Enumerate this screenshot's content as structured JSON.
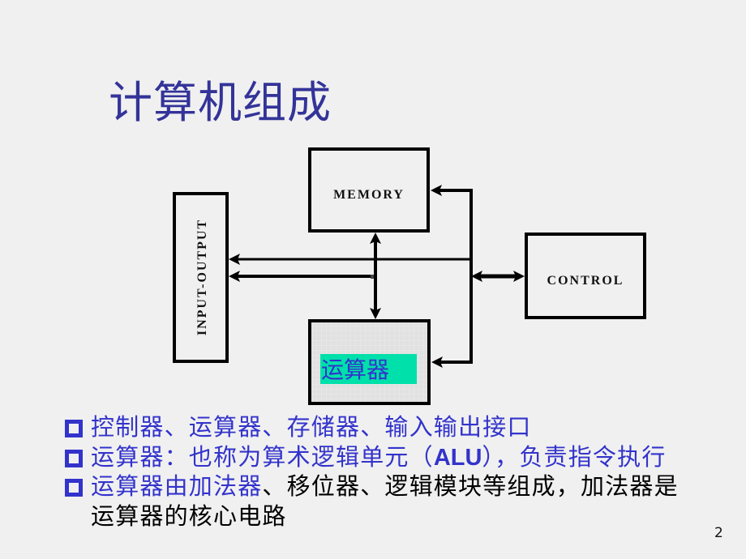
{
  "slide": {
    "title": "计算机组成",
    "page_number": "2"
  },
  "diagram": {
    "memory_label": "MEMORY",
    "control_label": "CONTROL",
    "io_label": "INPUT-OUTPUT",
    "alu_label": "运算器"
  },
  "bullets": [
    {
      "segments": [
        {
          "text": "控制器、运算器、存储器、输入输出接口",
          "color": "blue"
        }
      ]
    },
    {
      "segments": [
        {
          "text": "运算器：也称为算术逻辑单元（",
          "color": "blue"
        },
        {
          "text": "ALU",
          "color": "blue",
          "bold": true
        },
        {
          "text": "），负责指令执行",
          "color": "blue"
        }
      ]
    },
    {
      "segments": [
        {
          "text": "运算器由加法器",
          "color": "blue"
        },
        {
          "text": "、移位器、逻辑模块等组成，加法器是",
          "color": "black"
        }
      ],
      "continuation": "运算器的核心电路"
    }
  ],
  "colors": {
    "title": "#333399",
    "bullet_text": "#3333cc",
    "body_text": "#000000",
    "alu_highlight": "#00e0aa",
    "background": "#f0f0f0"
  }
}
